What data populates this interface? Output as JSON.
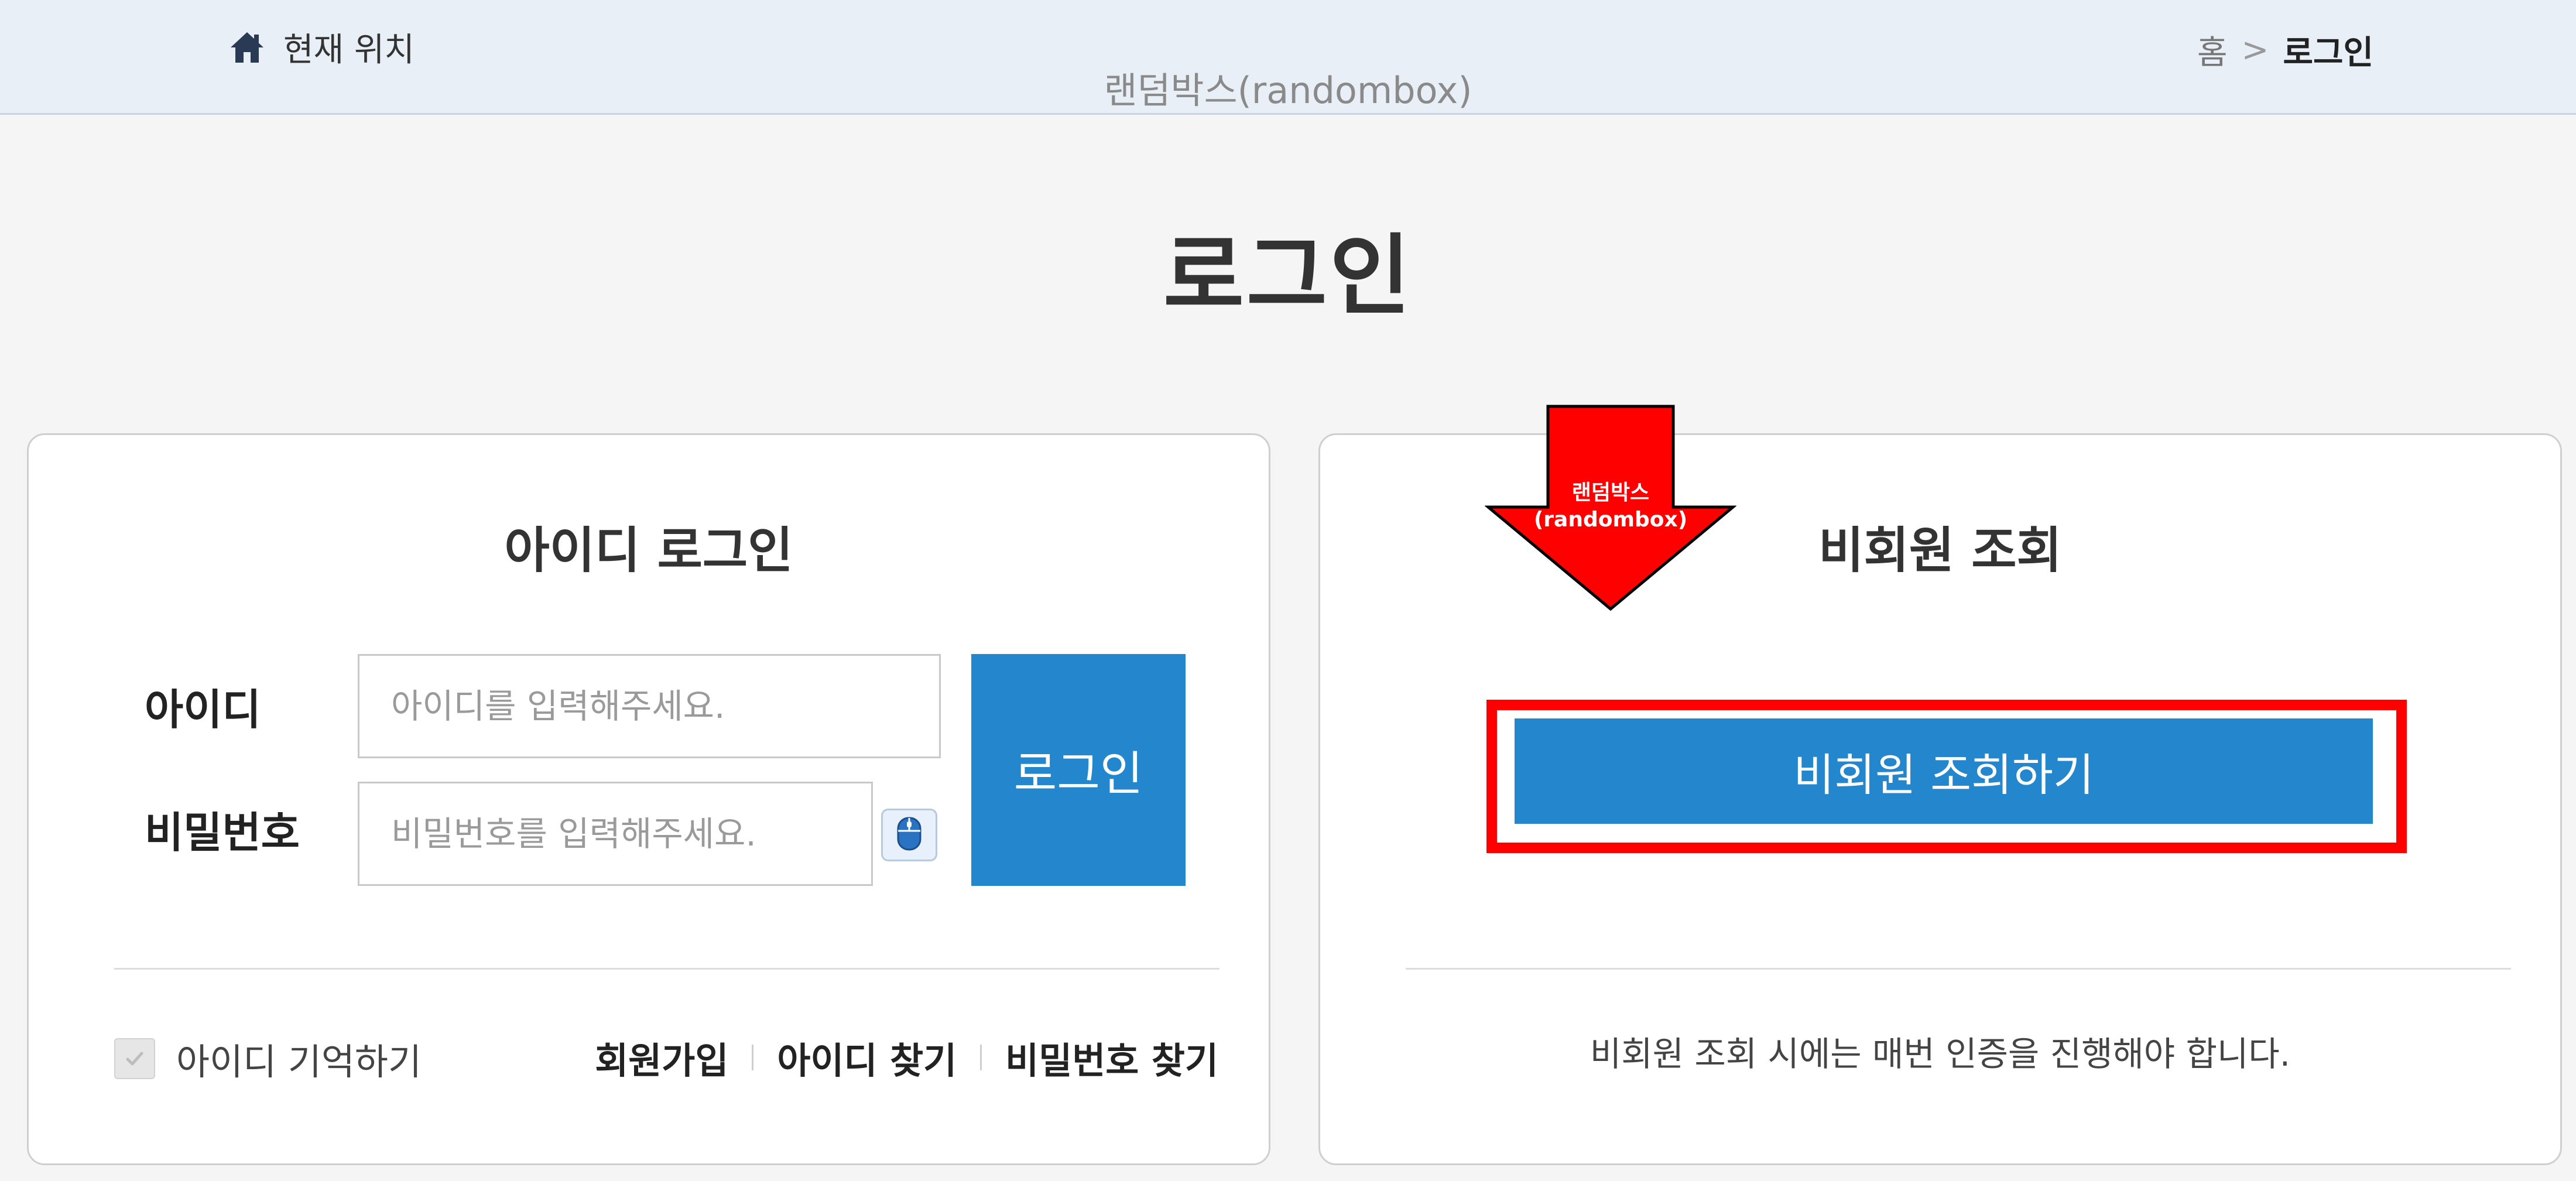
{
  "header": {
    "location_label": "현재 위치",
    "watermark": "랜덤박스(randombox)",
    "breadcrumb": {
      "home": "홈",
      "separator": ">",
      "current": "로그인"
    }
  },
  "page": {
    "title": "로그인"
  },
  "id_login": {
    "title": "아이디 로그인",
    "id_label": "아이디",
    "id_placeholder": "아이디를 입력해주세요.",
    "pw_label": "비밀번호",
    "pw_placeholder": "비밀번호를 입력해주세요.",
    "login_button": "로그인",
    "remember_label": "아이디 기억하기",
    "links": {
      "signup": "회원가입",
      "find_id": "아이디 찾기",
      "find_pw": "비밀번호 찾기"
    }
  },
  "guest": {
    "title": "비회원 조회",
    "button": "비회원 조회하기",
    "note": "비회원 조회 시에는 매번 인증을 진행해야 합니다."
  },
  "overlay": {
    "arrow_line1": "랜덤박스",
    "arrow_line2": "(randombox)"
  },
  "colors": {
    "primary_button": "#2487cd",
    "highlight_box": "#ff0000",
    "header_bg": "#e9eff7",
    "page_bg": "#f5f5f5"
  },
  "icons": {
    "location": "home-icon",
    "virtual_keyboard": "mouse-icon",
    "remember_check": "check-icon"
  }
}
